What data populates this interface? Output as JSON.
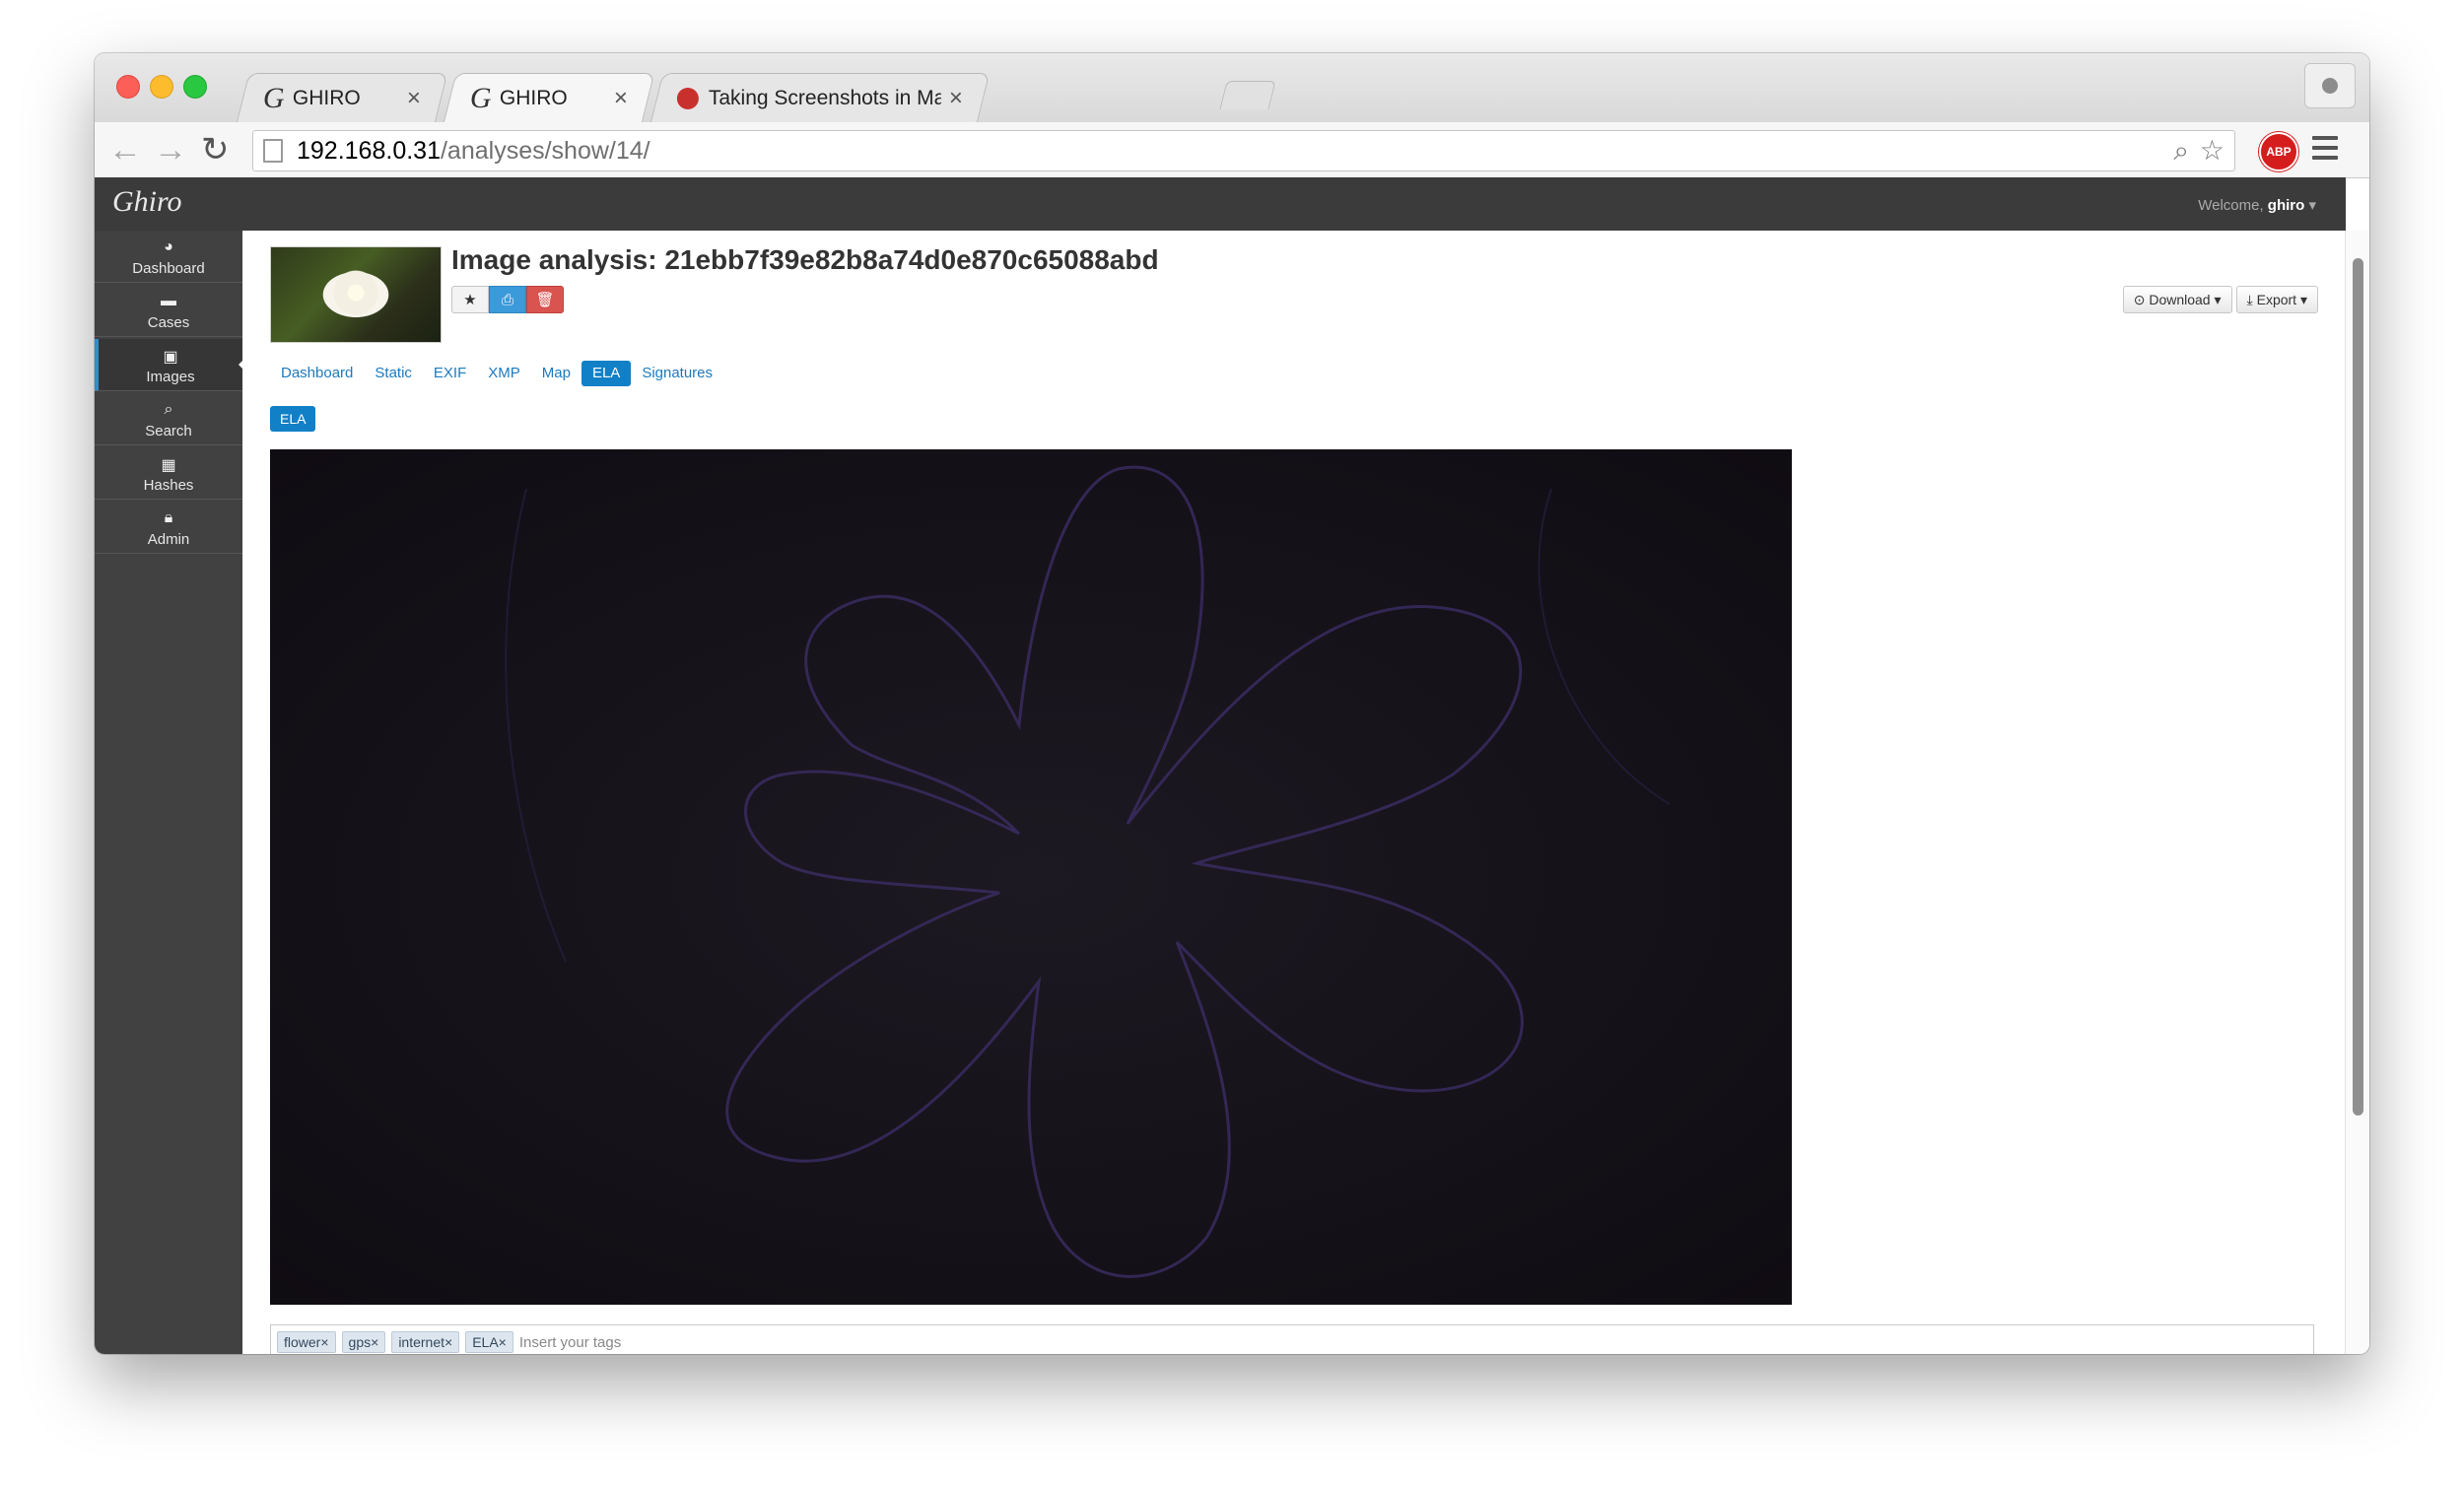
{
  "browser": {
    "tabs": [
      {
        "favicon": "G",
        "title": "GHIRO",
        "close": "×",
        "active": false
      },
      {
        "favicon": "G",
        "title": "GHIRO",
        "close": "×",
        "active": true
      },
      {
        "favicon": "",
        "title": "Taking Screenshots in Mac",
        "close": "×",
        "active": false
      }
    ],
    "url": {
      "host": "192.168.0.31",
      "path": "/analyses/show/14/"
    },
    "extension_badge": "ABP",
    "icons": {
      "back": "arrow-left-icon",
      "forward": "arrow-right-icon",
      "reload": "reload-icon",
      "search": "zoom-icon",
      "bookmark": "star-icon",
      "menu": "hamburger-menu-icon",
      "profile": "person-icon"
    }
  },
  "app": {
    "logo": "Ghiro",
    "welcome_prefix": "Welcome, ",
    "welcome_user": "ghiro",
    "sidebar": {
      "items": [
        {
          "label": "Dashboard",
          "icon": "dashboard-icon"
        },
        {
          "label": "Cases",
          "icon": "briefcase-icon"
        },
        {
          "label": "Images",
          "icon": "picture-icon",
          "active": true
        },
        {
          "label": "Search",
          "icon": "search-icon"
        },
        {
          "label": "Hashes",
          "icon": "table-icon"
        },
        {
          "label": "Admin",
          "icon": "lock-icon"
        }
      ]
    },
    "analysis": {
      "title": "Image analysis: 21ebb7f39e82b8a74d0e870c65088abd",
      "actions": {
        "star": "star-icon",
        "print": "print-icon",
        "delete": "trash-icon"
      },
      "download_label": "Download",
      "export_label": "Export",
      "tabs": [
        "Dashboard",
        "Static",
        "EXIF",
        "XMP",
        "Map",
        "ELA",
        "Signatures"
      ],
      "active_tab": "ELA",
      "section_label": "ELA",
      "tags": [
        "flower",
        "gps",
        "internet",
        "ELA"
      ],
      "tag_remove": "×",
      "tags_placeholder": "Insert your tags"
    }
  },
  "colors": {
    "accent": "#1180c7",
    "danger": "#d9534f",
    "topbar": "#3b3b3b",
    "sidebar": "#414141",
    "ela_background": "#141018"
  }
}
